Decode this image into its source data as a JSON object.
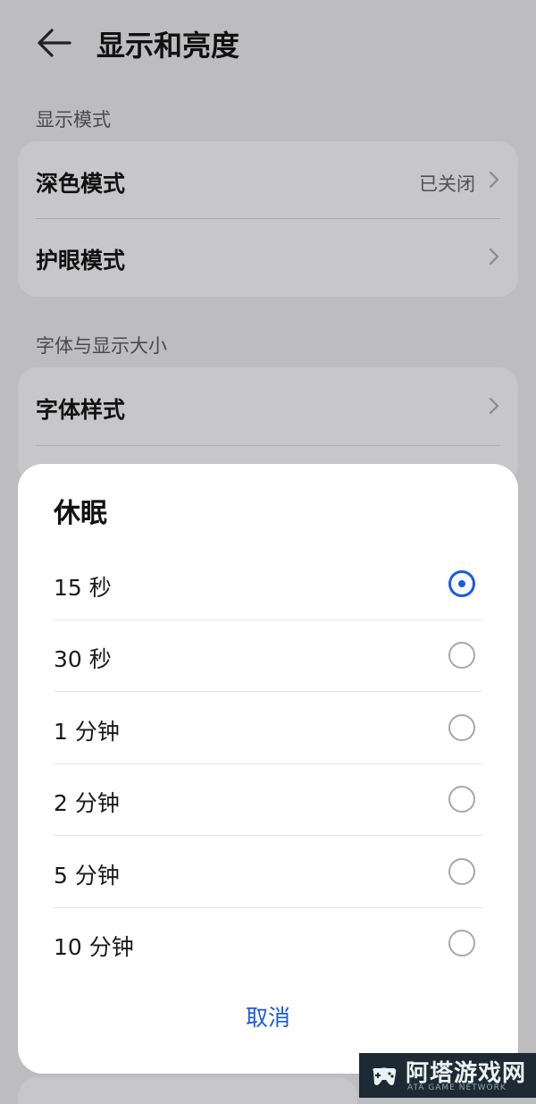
{
  "header": {
    "title": "显示和亮度",
    "back_icon": "arrow-left-icon"
  },
  "sections": {
    "display_mode": {
      "label": "显示模式",
      "items": [
        {
          "label": "深色模式",
          "value": "已关闭"
        },
        {
          "label": "护眼模式"
        }
      ]
    },
    "font_size": {
      "label": "字体与显示大小",
      "items": [
        {
          "label": "字体样式"
        }
      ]
    }
  },
  "sleep_dialog": {
    "title": "休眠",
    "options": [
      {
        "label": "15 秒",
        "selected": true
      },
      {
        "label": "30 秒",
        "selected": false
      },
      {
        "label": "1 分钟",
        "selected": false
      },
      {
        "label": "2 分钟",
        "selected": false
      },
      {
        "label": "5 分钟",
        "selected": false
      },
      {
        "label": "10 分钟",
        "selected": false
      }
    ],
    "cancel_label": "取消"
  },
  "watermark": {
    "text": "阿塔游戏网",
    "subtext": "ATA GAME NETWORK"
  },
  "colors": {
    "accent": "#1a5ae0",
    "background": "#bdbdbf",
    "dialog": "#ffffff"
  }
}
